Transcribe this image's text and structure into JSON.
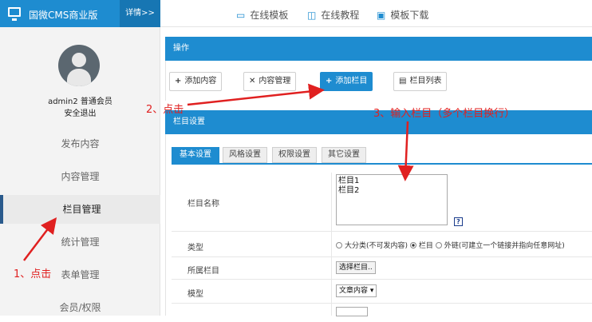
{
  "topbar": {
    "brand_title": "国微CMS商业版",
    "detail_label": "详情>>",
    "nav": [
      {
        "label": "在线模板",
        "icon": "monitor-icon"
      },
      {
        "label": "在线教程",
        "icon": "book-icon"
      },
      {
        "label": "模板下载",
        "icon": "download-icon"
      }
    ]
  },
  "sidebar": {
    "user": "admin2 普通会员",
    "logout": "安全退出",
    "items": [
      "发布内容",
      "内容管理",
      "栏目管理",
      "统计管理",
      "表单管理",
      "会员/权限"
    ],
    "active_index": 2
  },
  "main": {
    "ops_title": "操作",
    "buttons": [
      "添加内容",
      "内容管理",
      "添加栏目",
      "栏目列表"
    ],
    "settings_title": "栏目设置",
    "tabs": [
      "基本设置",
      "风格设置",
      "权限设置",
      "其它设置"
    ],
    "form": {
      "name_label": "栏目名称",
      "name_value": "栏目1\n栏目2",
      "help_glyph": "?",
      "type_label": "类型",
      "type_options": [
        "大分类(不可发内容)",
        "栏目",
        "外链(可建立一个链接并指向任意网址)"
      ],
      "type_selected": 1,
      "parent_label": "所属栏目",
      "parent_button": "选择栏目..",
      "model_label": "模型",
      "model_value": "文章内容"
    }
  },
  "annotations": {
    "step1": "1、点击",
    "step2": "2、点击",
    "step3": "3、输入栏目（多个栏目换行）"
  },
  "colors": {
    "accent": "#1e8cd0",
    "annotation": "#e02020",
    "sidebar_bg": "#f3f3f3"
  }
}
